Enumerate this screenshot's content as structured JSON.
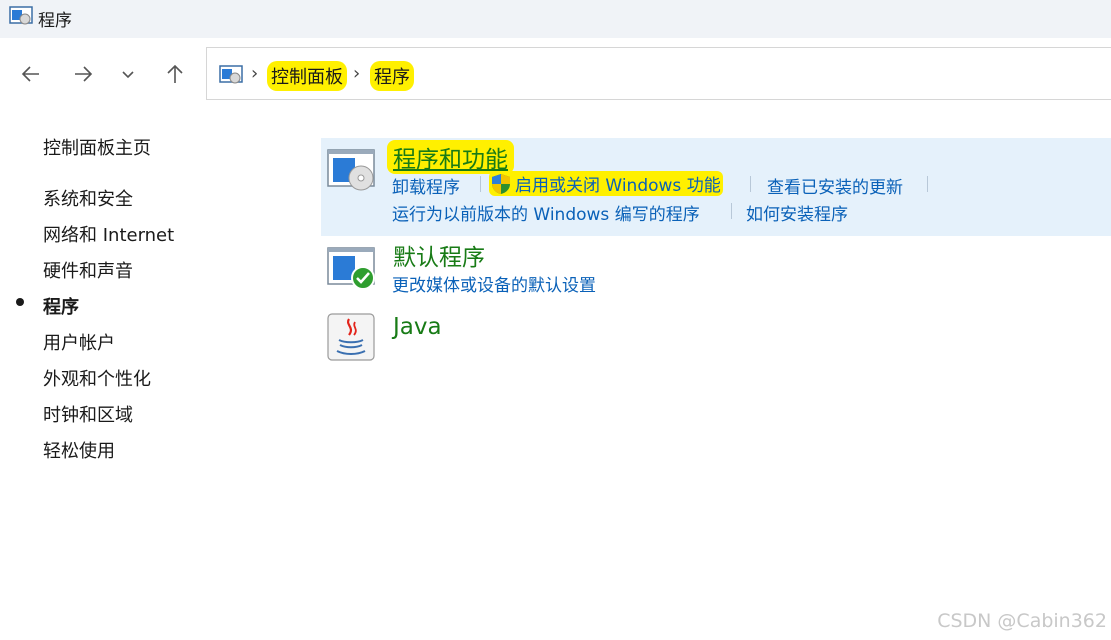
{
  "window": {
    "title": "程序"
  },
  "addressbar": {
    "crumbs": [
      "控制面板",
      "程序"
    ]
  },
  "sidebar": {
    "home": "控制面板主页",
    "items": [
      {
        "label": "系统和安全"
      },
      {
        "label": "网络和 Internet"
      },
      {
        "label": "硬件和声音"
      },
      {
        "label": "程序"
      },
      {
        "label": "用户帐户"
      },
      {
        "label": "外观和个性化"
      },
      {
        "label": "时钟和区域"
      },
      {
        "label": "轻松使用"
      }
    ]
  },
  "categories": {
    "programs_features": {
      "title": "程序和功能",
      "tasks": [
        "卸载程序",
        "启用或关闭 Windows 功能",
        "查看已安装的更新",
        "运行为以前版本的 Windows 编写的程序",
        "如何安装程序"
      ]
    },
    "default_programs": {
      "title": "默认程序",
      "tasks": [
        "更改媒体或设备的默认设置"
      ]
    },
    "java": {
      "title": "Java"
    }
  },
  "watermark": "CSDN @Cabin362",
  "colors": {
    "link_blue": "#0a61b8",
    "category_green": "#187b16",
    "highlight_yellow": "#fff000",
    "hover_bg": "#e5f1fb"
  }
}
